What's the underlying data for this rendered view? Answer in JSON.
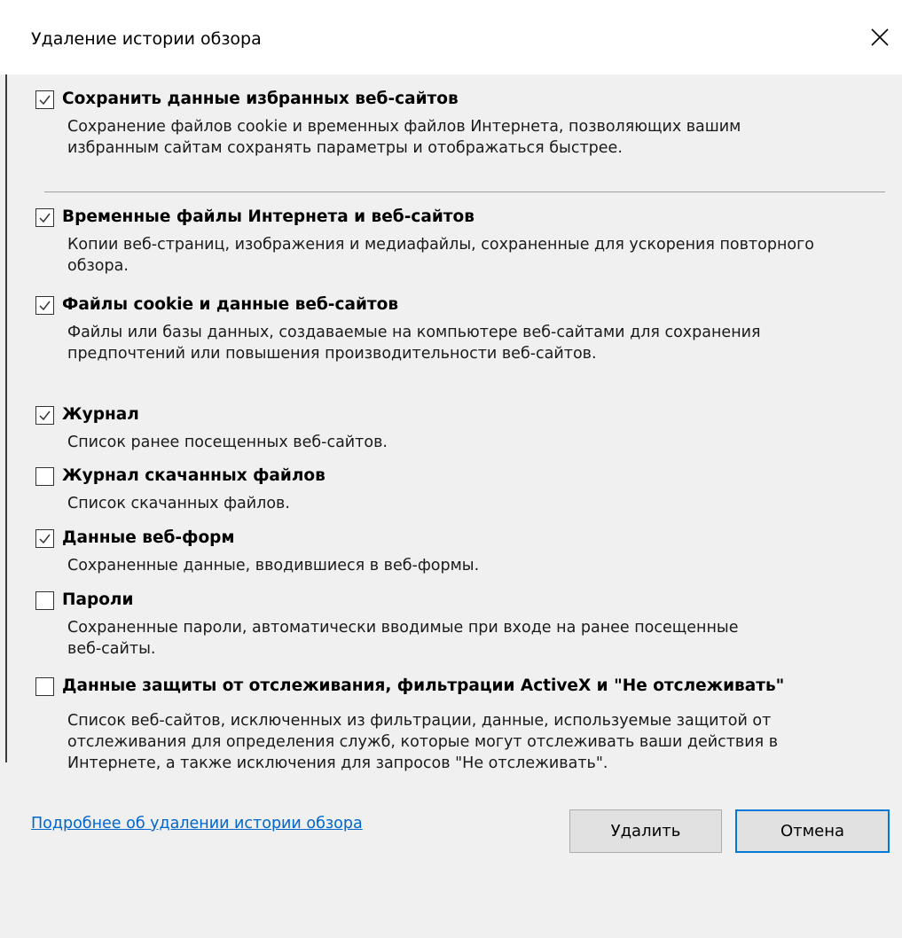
{
  "dialog": {
    "title": "Удаление истории обзора",
    "close_icon": "close-icon"
  },
  "options": [
    {
      "label": "Сохранить данные избранных веб-сайтов",
      "description_lines": [
        "Сохранение файлов cookie и временных файлов Интернета, позволяющих вашим",
        "избранным сайтам сохранять параметры и отображаться быстрее."
      ],
      "checked": true
    },
    {
      "label": "Временные файлы Интернета и веб-сайтов",
      "description_lines": [
        "Копии веб-страниц, изображения и медиафайлы, сохраненные для ускорения повторного",
        "обзора."
      ],
      "checked": true
    },
    {
      "label": "Файлы cookie и данные веб-сайтов",
      "description_lines": [
        "Файлы или базы данных, создаваемые на компьютере веб-сайтами для сохранения",
        "предпочтений или повышения производительности веб-сайтов."
      ],
      "checked": true
    },
    {
      "label": "Журнал",
      "description_lines": [
        "Список ранее посещенных веб-сайтов."
      ],
      "checked": true
    },
    {
      "label": "Журнал скачанных файлов",
      "description_lines": [
        "Список скачанных файлов."
      ],
      "checked": false
    },
    {
      "label": "Данные веб-форм",
      "description_lines": [
        "Сохраненные данные, вводившиеся в веб-формы."
      ],
      "checked": true
    },
    {
      "label": "Пароли",
      "description_lines": [
        "Сохраненные пароли, автоматически вводимые при входе на ранее посещенные",
        "веб-сайты."
      ],
      "checked": false
    },
    {
      "label": "Данные защиты от отслеживания, фильтрации ActiveX и \"Не отслеживать\"",
      "description_lines": [
        "Список веб-сайтов, исключенных из фильтрации, данные, используемые защитой от",
        "отслеживания для определения служб, которые могут отслеживать ваши действия в",
        "Интернете, а также исключения для запросов \"Не отслеживать\"."
      ],
      "checked": false
    }
  ],
  "footer": {
    "help_link": "Подробнее об удалении истории обзора",
    "delete_label": "Удалить",
    "cancel_label": "Отмена"
  },
  "colors": {
    "background": "#f0f0f0",
    "link": "#0066cc",
    "accent": "#0078d7"
  }
}
